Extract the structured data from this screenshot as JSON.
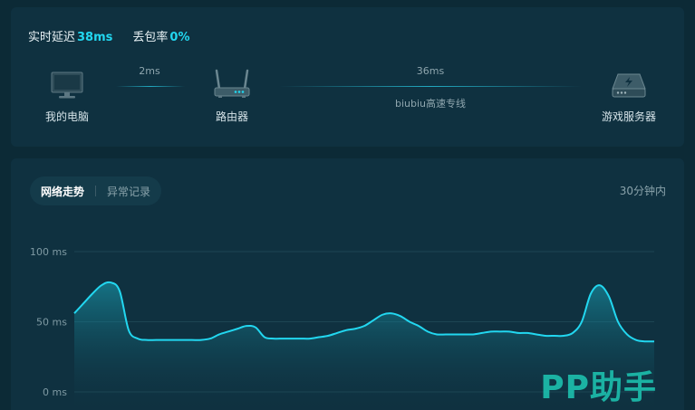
{
  "stats": {
    "latency_label": "实时延迟",
    "latency_value": "38ms",
    "loss_label": "丢包率",
    "loss_value": "0%"
  },
  "route": {
    "nodes": [
      {
        "label": "我的电脑",
        "icon": "monitor-icon"
      },
      {
        "label": "路由器",
        "icon": "router-icon"
      },
      {
        "label": "游戏服务器",
        "icon": "server-icon"
      }
    ],
    "links": [
      {
        "ms": "2ms",
        "sub": ""
      },
      {
        "ms": "36ms",
        "sub": "biubiu高速专线"
      }
    ]
  },
  "tabs": [
    {
      "label": "网络走势",
      "active": true
    },
    {
      "label": "异常记录",
      "active": false
    }
  ],
  "range_label": "30分钟内",
  "watermark": "PP助手",
  "colors": {
    "accent": "#22d7f0",
    "background": "#0c2a36",
    "card": "#0f3140",
    "watermark": "#1ec8b4"
  },
  "chart_data": {
    "type": "area",
    "title": "",
    "ylabel": "",
    "xlabel": "",
    "ylim": [
      0,
      100
    ],
    "yticks": [
      "100 ms",
      "50 ms",
      "0 ms"
    ],
    "x": [
      0,
      1,
      2,
      3,
      4,
      5,
      6,
      7,
      8,
      9,
      10,
      11,
      12,
      13,
      14,
      15,
      16,
      17,
      18,
      19,
      20,
      21,
      22,
      23,
      24,
      25,
      26,
      27,
      28,
      29,
      30,
      31,
      32,
      33,
      34,
      35,
      36,
      37,
      38,
      39,
      40,
      41,
      42,
      43,
      44,
      45,
      46,
      47,
      48,
      49,
      50,
      51,
      52,
      53,
      54,
      55,
      56,
      57,
      58,
      59,
      60,
      61,
      62,
      63,
      64
    ],
    "series": [
      {
        "values": [
          56,
          63,
          70,
          76,
          78,
          72,
          44,
          38,
          37,
          37,
          37,
          37,
          37,
          37,
          37,
          38,
          41,
          43,
          45,
          47,
          46,
          39,
          38,
          38,
          38,
          38,
          38,
          39,
          40,
          42,
          44,
          45,
          47,
          51,
          55,
          56,
          54,
          50,
          47,
          43,
          41,
          41,
          41,
          41,
          41,
          42,
          43,
          43,
          43,
          42,
          42,
          41,
          40,
          40,
          40,
          42,
          50,
          70,
          76,
          68,
          50,
          41,
          37,
          36,
          36
        ]
      }
    ],
    "grid": true,
    "legend": "none"
  }
}
